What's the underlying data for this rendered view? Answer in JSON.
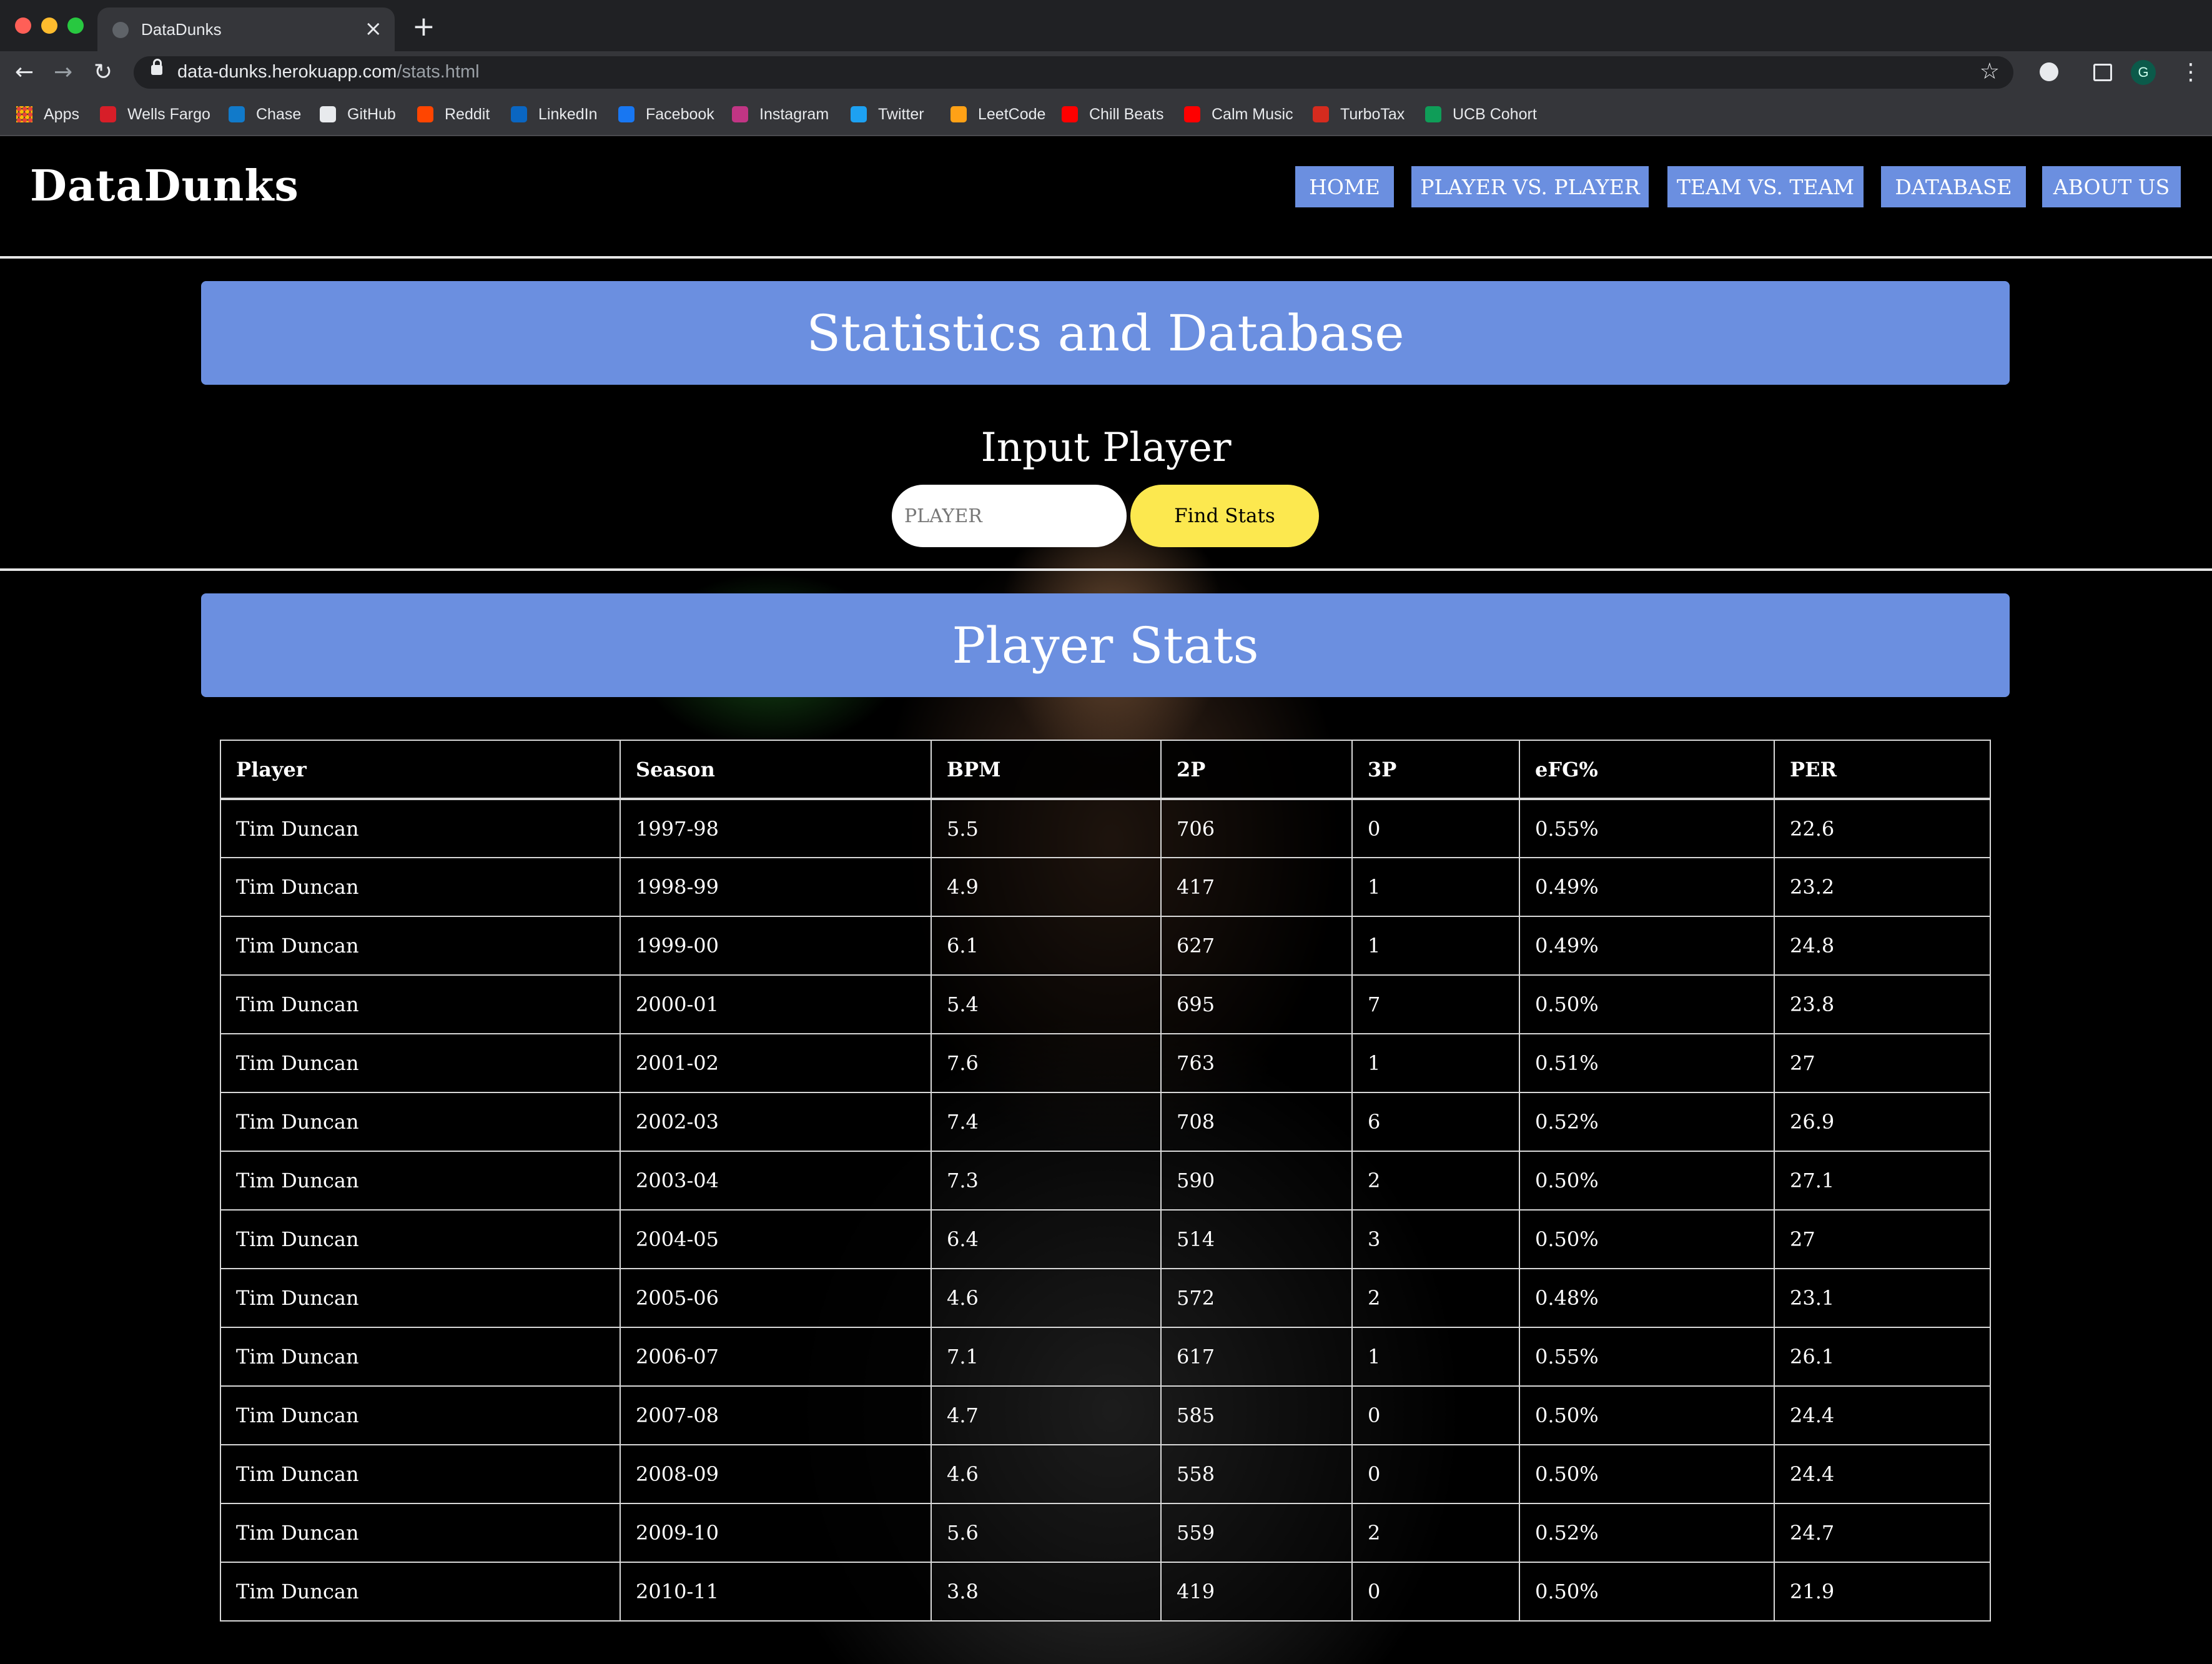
{
  "browser": {
    "tab_title": "DataDunks",
    "tab_close": "×",
    "new_tab": "+",
    "back": "←",
    "forward": "→",
    "reload": "↻",
    "url_host": "data-dunks.herokuapp.com",
    "url_path": "/stats.html",
    "star": "☆",
    "profile_initial": "G",
    "menu": "⋮",
    "bookmarks": [
      {
        "label": "Apps",
        "icon": "apps-grid-icon",
        "color": "#ea4335"
      },
      {
        "label": "Wells Fargo",
        "icon": "wells-fargo-icon",
        "color": "#d71e28"
      },
      {
        "label": "Chase",
        "icon": "chase-icon",
        "color": "#117aca"
      },
      {
        "label": "GitHub",
        "icon": "github-icon",
        "color": "#e8eaed"
      },
      {
        "label": "Reddit",
        "icon": "reddit-icon",
        "color": "#ff4500"
      },
      {
        "label": "LinkedIn",
        "icon": "linkedin-icon",
        "color": "#0a66c2"
      },
      {
        "label": "Facebook",
        "icon": "facebook-icon",
        "color": "#1877f2"
      },
      {
        "label": "Instagram",
        "icon": "instagram-icon",
        "color": "#c13584"
      },
      {
        "label": "Twitter",
        "icon": "twitter-icon",
        "color": "#1da1f2"
      },
      {
        "label": "LeetCode",
        "icon": "leetcode-icon",
        "color": "#ffa116"
      },
      {
        "label": "Chill Beats",
        "icon": "youtube-icon",
        "color": "#ff0000"
      },
      {
        "label": "Calm Music",
        "icon": "youtube-icon",
        "color": "#ff0000"
      },
      {
        "label": "TurboTax",
        "icon": "turbotax-icon",
        "color": "#d52b1e"
      },
      {
        "label": "UCB Cohort",
        "icon": "sheets-icon",
        "color": "#0f9d58"
      }
    ]
  },
  "site": {
    "brand": "DataDunks",
    "nav": [
      "HOME",
      "PLAYER VS. PLAYER",
      "TEAM VS. TEAM",
      "DATABASE",
      "ABOUT US"
    ],
    "accent_color": "#6b8fe0",
    "button_color": "#fce84f"
  },
  "main": {
    "banner_title": "Statistics and Database",
    "input_heading": "Input Player",
    "input_placeholder": "PLAYER",
    "find_button": "Find Stats",
    "stats_title": "Player Stats"
  },
  "table": {
    "columns": [
      "Player",
      "Season",
      "BPM",
      "2P",
      "3P",
      "eFG%",
      "PER"
    ],
    "rows": [
      [
        "Tim Duncan",
        "1997-98",
        "5.5",
        "706",
        "0",
        "0.55%",
        "22.6"
      ],
      [
        "Tim Duncan",
        "1998-99",
        "4.9",
        "417",
        "1",
        "0.49%",
        "23.2"
      ],
      [
        "Tim Duncan",
        "1999-00",
        "6.1",
        "627",
        "1",
        "0.49%",
        "24.8"
      ],
      [
        "Tim Duncan",
        "2000-01",
        "5.4",
        "695",
        "7",
        "0.50%",
        "23.8"
      ],
      [
        "Tim Duncan",
        "2001-02",
        "7.6",
        "763",
        "1",
        "0.51%",
        "27"
      ],
      [
        "Tim Duncan",
        "2002-03",
        "7.4",
        "708",
        "6",
        "0.52%",
        "26.9"
      ],
      [
        "Tim Duncan",
        "2003-04",
        "7.3",
        "590",
        "2",
        "0.50%",
        "27.1"
      ],
      [
        "Tim Duncan",
        "2004-05",
        "6.4",
        "514",
        "3",
        "0.50%",
        "27"
      ],
      [
        "Tim Duncan",
        "2005-06",
        "4.6",
        "572",
        "2",
        "0.48%",
        "23.1"
      ],
      [
        "Tim Duncan",
        "2006-07",
        "7.1",
        "617",
        "1",
        "0.55%",
        "26.1"
      ],
      [
        "Tim Duncan",
        "2007-08",
        "4.7",
        "585",
        "0",
        "0.50%",
        "24.4"
      ],
      [
        "Tim Duncan",
        "2008-09",
        "4.6",
        "558",
        "0",
        "0.50%",
        "24.4"
      ],
      [
        "Tim Duncan",
        "2009-10",
        "5.6",
        "559",
        "2",
        "0.52%",
        "24.7"
      ],
      [
        "Tim Duncan",
        "2010-11",
        "3.8",
        "419",
        "0",
        "0.50%",
        "21.9"
      ]
    ]
  }
}
